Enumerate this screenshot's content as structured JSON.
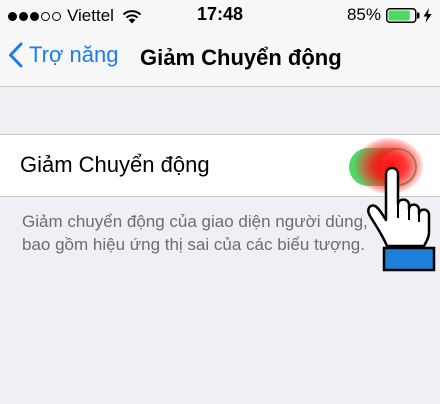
{
  "status_bar": {
    "signal_bars_filled": 3,
    "signal_bars_total": 5,
    "carrier": "Viettel",
    "time": "17:48",
    "battery_percent_label": "85%",
    "battery_level": 0.85,
    "icons": [
      "signal-dots-icon",
      "wifi-icon",
      "battery-icon",
      "charging-bolt-icon"
    ]
  },
  "nav": {
    "back_label": "Trợ năng",
    "title": "Giảm Chuyển động"
  },
  "settings": {
    "reduce_motion": {
      "label": "Giảm Chuyển động",
      "enabled": true
    },
    "footer_lines": [
      "Giảm chuyển động của giao diện người dùng,",
      "bao gồm hiệu ứng thị sai của các biểu tượng."
    ]
  },
  "colors": {
    "accent": "#1a7cf5",
    "toggle_on": "#4cd964",
    "background": "#efeff4",
    "tap_highlight": "#ff1a1a",
    "hand_cuff": "#1e7fd8"
  },
  "overlay": {
    "icon": "pointing-hand-icon"
  }
}
